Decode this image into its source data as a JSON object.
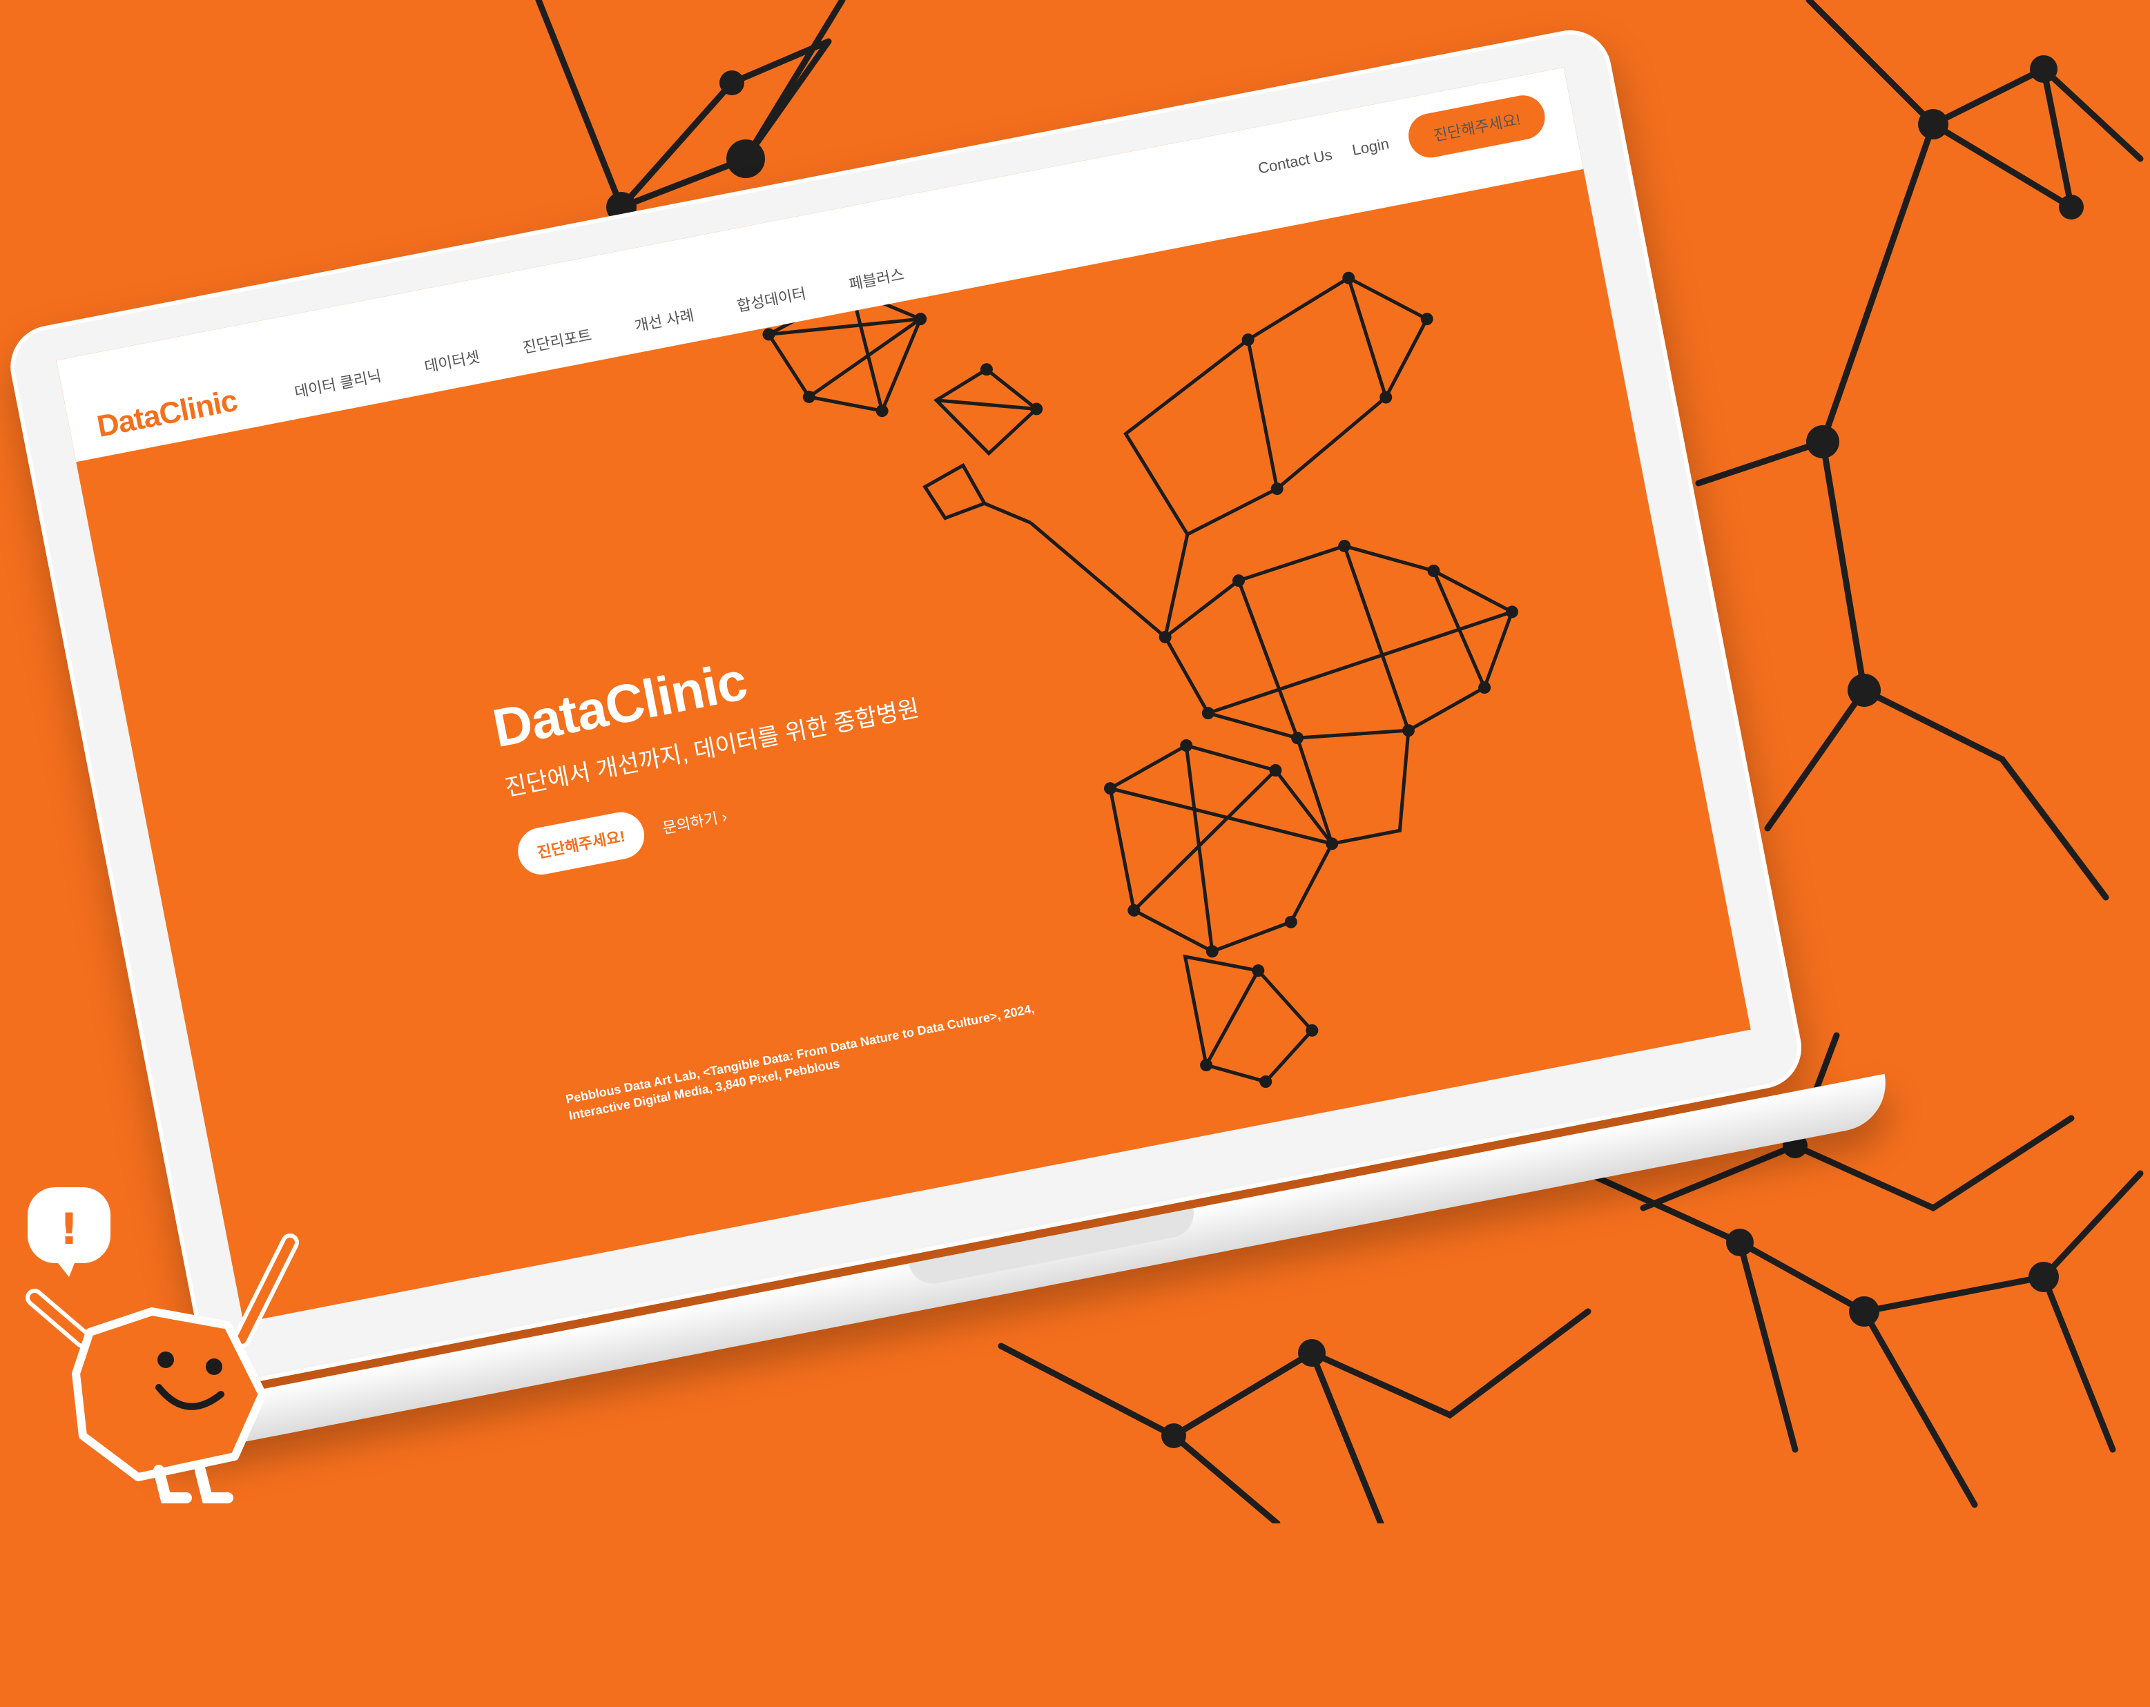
{
  "header": {
    "logo": "DataClinic",
    "nav": [
      "데이터 클리닉",
      "데이터셋",
      "진단리포트",
      "개선 사례",
      "합성데이터",
      "페블러스"
    ],
    "contact": "Contact Us",
    "login": "Login",
    "cta": "진단해주세요!"
  },
  "hero": {
    "title": "DataClinic",
    "subtitle": "진단에서 개선까지, 데이터를 위한 종합병원",
    "cta": "진단해주세요!",
    "inquiry": "문의하기",
    "inquiry_icon": "chevron-right-icon",
    "caption_line1": "Pebblous Data Art Lab, <Tangible Data: From Data Nature to Data Culture>, 2024,",
    "caption_line2": "Interactive Digital Media, 3,840 Pixel, Pebblous"
  },
  "mascot": {
    "bubble_glyph": "!"
  },
  "colors": {
    "brand_orange": "#f4701c",
    "white": "#ffffff",
    "network": "#1c1c1c"
  }
}
